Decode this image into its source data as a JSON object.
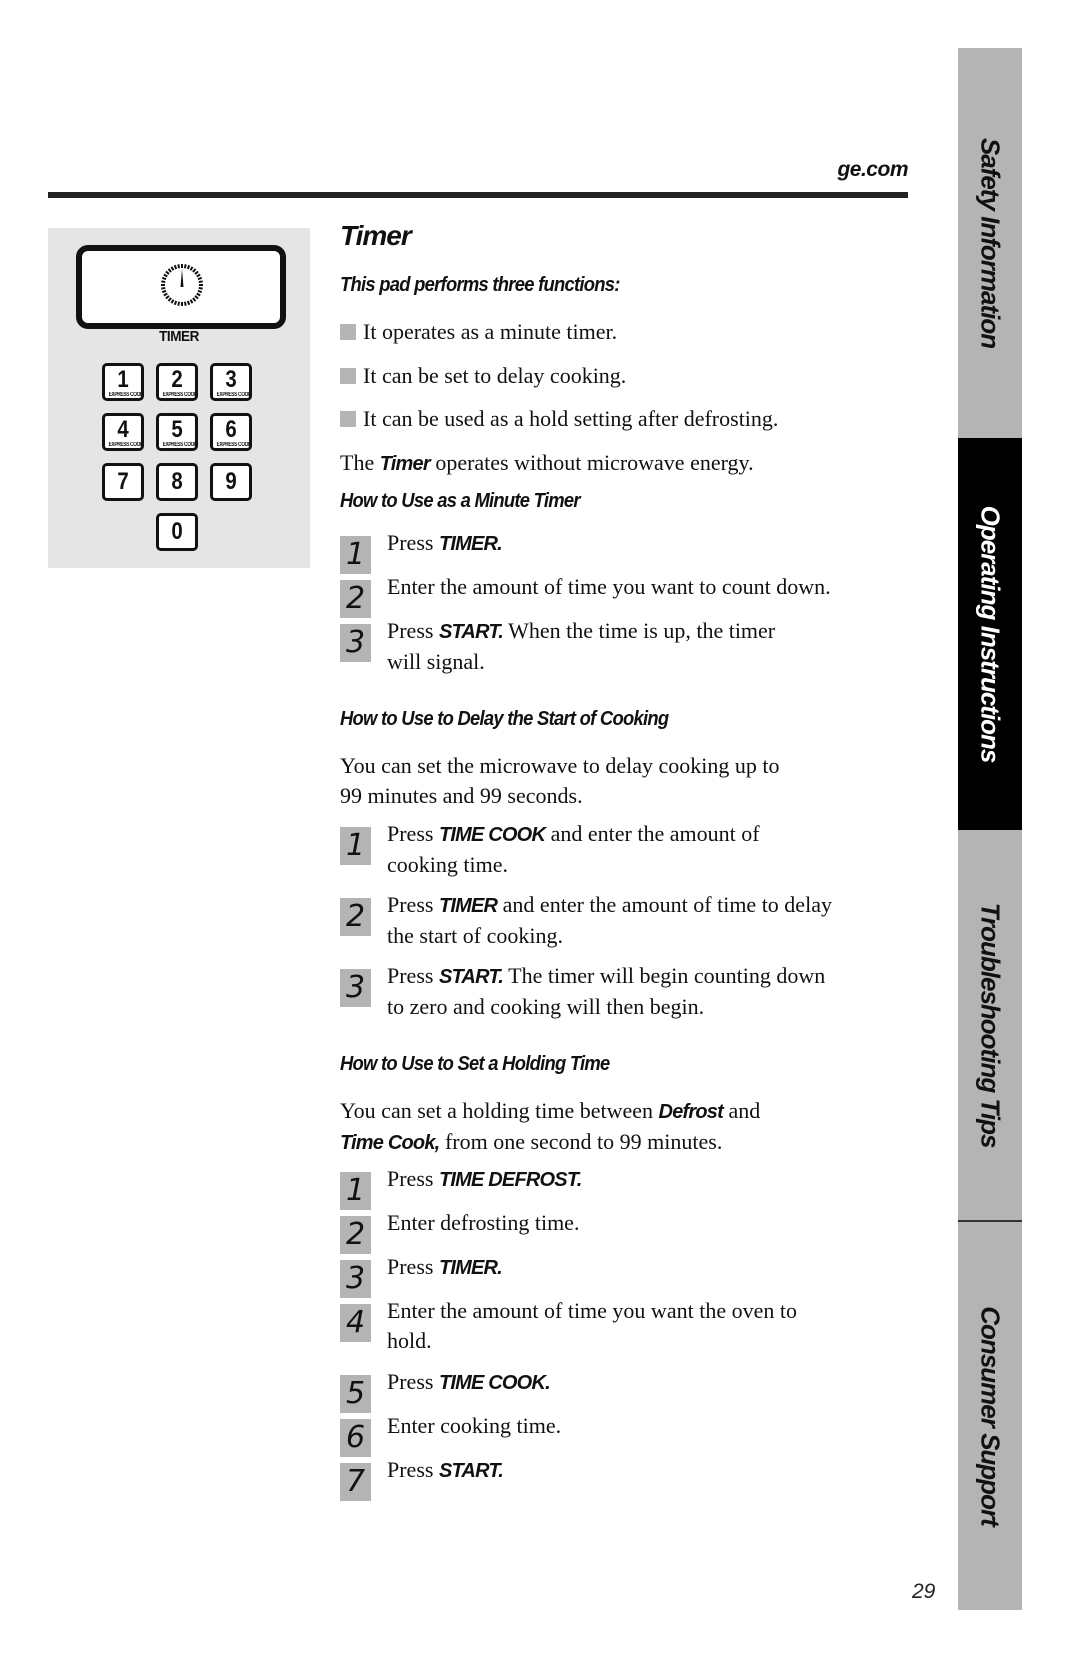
{
  "header": {
    "site_url": "ge.com"
  },
  "panel": {
    "timer_label": "TIMER",
    "keys": [
      {
        "num": "1",
        "sub": "EXPRESS COOK"
      },
      {
        "num": "2",
        "sub": "EXPRESS COOK"
      },
      {
        "num": "3",
        "sub": "EXPRESS COOK"
      },
      {
        "num": "4",
        "sub": "EXPRESS COOK"
      },
      {
        "num": "5",
        "sub": "EXPRESS COOK"
      },
      {
        "num": "6",
        "sub": "EXPRESS COOK"
      },
      {
        "num": "7",
        "sub": ""
      },
      {
        "num": "8",
        "sub": ""
      },
      {
        "num": "9",
        "sub": ""
      },
      {
        "num": "0",
        "sub": ""
      }
    ]
  },
  "content": {
    "title": "Timer",
    "intro_heading": "This pad performs three functions:",
    "bullets": [
      "It operates as a minute timer.",
      "It can be set to delay cooking.",
      "It can be used as a hold setting after defrosting."
    ],
    "note": {
      "pre": "The ",
      "kw": "Timer",
      "post": " operates without microwave energy."
    },
    "sections": [
      {
        "heading": "How to Use as a Minute Timer",
        "steps": [
          {
            "n": "1",
            "lines": [
              [
                "Press ",
                "TIMER."
              ]
            ]
          },
          {
            "n": "2",
            "lines": [
              [
                "Enter the amount of time you want to count down."
              ]
            ]
          },
          {
            "n": "3",
            "lines": [
              [
                "Press ",
                "START.",
                " When the time is up, the timer"
              ],
              [
                "will signal."
              ]
            ]
          }
        ]
      },
      {
        "heading": "How to Use to Delay the Start of Cooking",
        "intro": [
          "You can set the microwave to delay cooking up to",
          "99 minutes and 99 seconds."
        ],
        "steps": [
          {
            "n": "1",
            "lines": [
              [
                "Press ",
                "TIME COOK",
                "  and enter the amount of"
              ],
              [
                "cooking time."
              ]
            ]
          },
          {
            "n": "2",
            "lines": [
              [
                "Press ",
                "TIMER",
                " and enter the amount of time to delay"
              ],
              [
                "the start of cooking."
              ]
            ]
          },
          {
            "n": "3",
            "lines": [
              [
                "Press ",
                "START.",
                " The timer will begin counting down"
              ],
              [
                "to zero and cooking will then begin."
              ]
            ]
          }
        ]
      },
      {
        "heading": "How to Use to Set a Holding Time",
        "intro_rich": [
          [
            "You can set a holding time between ",
            "Defrost",
            "  and"
          ],
          [
            "",
            "Time Cook,",
            " from one second to 99 minutes."
          ]
        ],
        "steps": [
          {
            "n": "1",
            "lines": [
              [
                "Press ",
                "TIME DEFROST."
              ]
            ]
          },
          {
            "n": "2",
            "lines": [
              [
                "Enter defrosting time."
              ]
            ]
          },
          {
            "n": "3",
            "lines": [
              [
                "Press ",
                "TIMER."
              ]
            ]
          },
          {
            "n": "4",
            "lines": [
              [
                "Enter the amount of time you want the oven to"
              ],
              [
                "hold."
              ]
            ]
          },
          {
            "n": "5",
            "lines": [
              [
                "Press ",
                "TIME COOK."
              ]
            ]
          },
          {
            "n": "6",
            "lines": [
              [
                "Enter cooking time."
              ]
            ]
          },
          {
            "n": "7",
            "lines": [
              [
                "Press ",
                "START."
              ]
            ]
          }
        ]
      }
    ]
  },
  "side_tabs": [
    {
      "label": "Safety Information",
      "active": false
    },
    {
      "label": "Operating Instructions",
      "active": true
    },
    {
      "label": "Troubleshooting Tips",
      "active": false
    },
    {
      "label": "Consumer Support",
      "active": false
    }
  ],
  "footer": {
    "page_number": "29"
  },
  "colors": {
    "tab_gray": "#b4b4b4",
    "tab_active": "#000000",
    "panel_bg": "#e5e5e5",
    "badge_gray": "#b4b4b4"
  }
}
